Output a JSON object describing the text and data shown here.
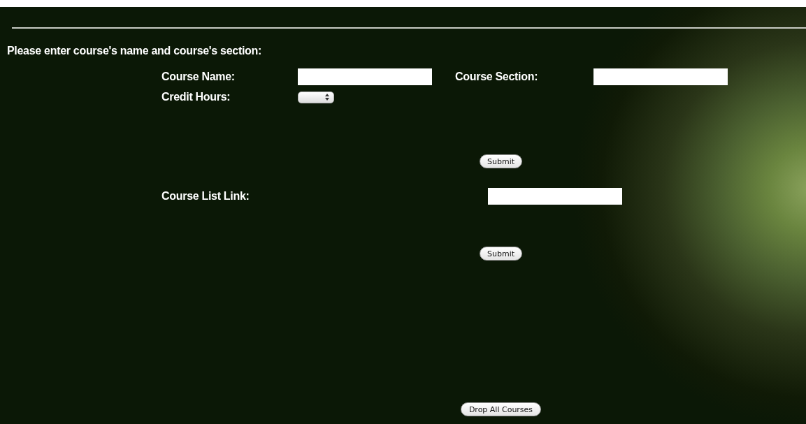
{
  "intro": "Please enter course's name and course's section:",
  "course_form": {
    "fields": [
      {
        "kind": "text",
        "label": "Course Name:"
      },
      {
        "kind": "text",
        "label": "Course Section:"
      },
      {
        "kind": "select",
        "label": "Credit Hours:"
      }
    ],
    "submit": "Submit"
  },
  "link_form": {
    "label": "Course List Link:",
    "submit": "Submit"
  },
  "drop_button": "Drop All Courses"
}
